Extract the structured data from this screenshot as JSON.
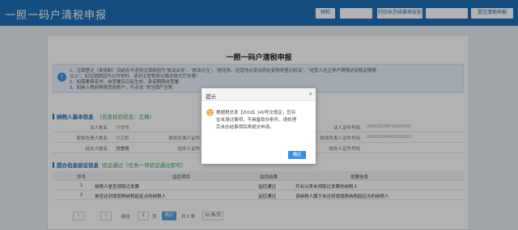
{
  "header": {
    "title": "一照一码户清税申报",
    "buttons": [
      {
        "label": "预检"
      },
      {
        "label": ""
      },
      {
        "label": "打印未办结事项告知书"
      },
      {
        "label": ""
      },
      {
        "label": "提交清税申报"
      }
    ]
  },
  "form": {
    "title": "一照一码户清税申报",
    "notice": {
      "line1": "1、注销登记（承诺制）目前办不适用注销原因为“依法合并”、“依法分立”、“居住所、经营地点变动而在变税务登记机关”、“经营人住正常户期限达到规定期限",
      "line2": "以上”；如注销原因为以列举时，请到主管税务分局办税大厅办理！",
      "line3": "2、如需要承诺书，自签署后日起生效，承诺期限自签署",
      "line4": "3、如纳入税前购换签告账户，可点击“ 快注销产生账"
    },
    "basic_section": {
      "title": "纳税人基本信息",
      "status": "（信息校验状态：正确）"
    },
    "basic_rows": [
      {
        "label1": "法人姓名",
        "value1": "洪雪倩",
        "label3": "法人证件号码",
        "value3": "350628198708020041"
      },
      {
        "label1": "财务负责人姓名",
        "value1": "洪泥鹏",
        "label2": "财务负责人证件",
        "label3": "财务负责人证件号码",
        "value3": "350628198401260010"
      },
      {
        "label1": "经办人姓名",
        "value1": "洪雪倩",
        "label2": "经办人证件",
        "label3": "经办人证件号码",
        "value3": ""
      }
    ],
    "check_section": {
      "title": "提办信息验证信息",
      "status": "验证通过（任务一项验证通过即可）"
    },
    "table": {
      "headers": [
        "序号",
        "监控项目",
        "监控结果",
        "提要信息"
      ],
      "rows": [
        {
          "no": "1",
          "item": "纳税人是否领取过发票",
          "result": "监控通过",
          "info": "开业以来未领取过发票的纳税人"
        },
        {
          "no": "2",
          "item": "是否达到增值税纳税起征点的纳税人",
          "result": "监控通过",
          "info": "该纳税人属于未达到增值税纳税起征点的纳税人"
        }
      ]
    },
    "pager": {
      "prev": "‹",
      "next": "›",
      "page": "1",
      "goto_label": "前往",
      "page_unit": "页",
      "confirm": "确定",
      "total": "共 2 条",
      "per_page": "10 条/页"
    }
  },
  "dialog": {
    "title": "提示",
    "close": "×",
    "message_lines": [
      "根据税总发【2018】149号文规定，您存",
      "在未清过事项，不具备即办条件，请处理",
      "完未办结事项后再提交申请。"
    ],
    "ok_label": "确定"
  },
  "colors": {
    "brand": "#1f6fb6",
    "primary_button": "#3a8ee6",
    "warning_icon": "#f0ad4e",
    "success": "#3aa35a"
  }
}
